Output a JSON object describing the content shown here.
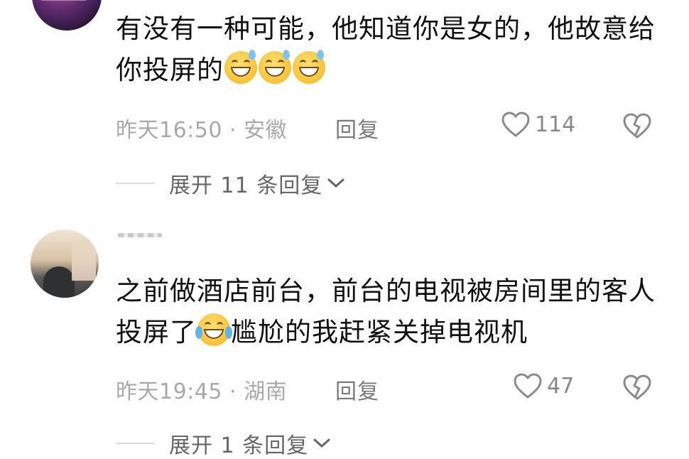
{
  "comments": [
    {
      "text": "有没有一种可能，他知道你是女的，他故意给你投屏的",
      "emojis": [
        "grinning-sweat-emoji",
        "grinning-sweat-emoji",
        "grinning-sweat-emoji"
      ],
      "meta": "昨天16:50 · 安徽",
      "reply_label": "回复",
      "likes": "114",
      "expand_label": "展开 11 条回复"
    },
    {
      "text_before_emoji": "之前做酒店前台，前台的电视被房间里的客人投屏了",
      "emoji": "tears-of-joy-emoji",
      "text_after_emoji": "尴尬的我赶紧关掉电视机",
      "meta": "昨天19:45 · 湖南",
      "reply_label": "回复",
      "likes": "47",
      "expand_label": "展开 1 条回复"
    }
  ],
  "icons": {
    "like": "heart-outline-icon",
    "dislike": "broken-heart-icon",
    "expand": "chevron-down-icon"
  },
  "colors": {
    "text": "#111111",
    "meta": "#a9a9a9",
    "icon": "#888888"
  }
}
